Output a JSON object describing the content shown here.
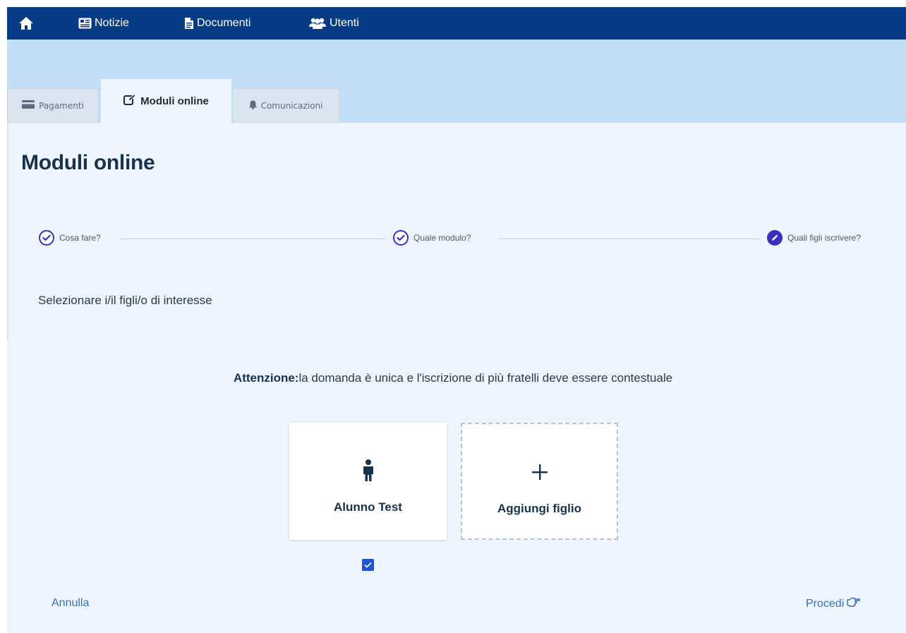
{
  "nav": {
    "home_icon": "home-icon",
    "items": [
      {
        "label": "Notizie",
        "icon": "newspaper-icon"
      },
      {
        "label": "Documenti",
        "icon": "document-icon"
      },
      {
        "label": "Utenti",
        "icon": "users-icon"
      }
    ]
  },
  "tabs": [
    {
      "label": "Pagamenti",
      "icon": "credit-card-icon",
      "active": false
    },
    {
      "label": "Moduli online",
      "icon": "edit-icon",
      "active": true
    },
    {
      "label": "Comunicazioni",
      "icon": "bell-icon",
      "active": false
    }
  ],
  "page": {
    "title": "Moduli online",
    "instruction": "Selezionare i/il figli/o di interesse",
    "warning_bold": "Attenzione:",
    "warning_text": "la domanda è unica e l'iscrizione di più fratelli deve essere contestuale"
  },
  "stepper": {
    "steps": [
      {
        "label": "Cosa fare?",
        "state": "done"
      },
      {
        "label": "Quale modulo?",
        "state": "done"
      },
      {
        "label": "Quali figli iscrivere?",
        "state": "current"
      }
    ]
  },
  "cards": {
    "child": {
      "label": "Alunno Test",
      "icon": "child-icon",
      "selected": true
    },
    "add": {
      "label": "Aggiungi figlio",
      "icon": "plus-icon"
    }
  },
  "footer": {
    "cancel_label": "Annulla",
    "proceed_label": "Procedi",
    "proceed_icon": "hand-pointing-icon"
  },
  "colors": {
    "nav_bg": "#073b85",
    "band_bg": "#c2def9",
    "content_bg": "#eef5ff",
    "step_accent": "#3b2fbf",
    "checkbox": "#1f53d6",
    "link": "#3b6fb0"
  }
}
